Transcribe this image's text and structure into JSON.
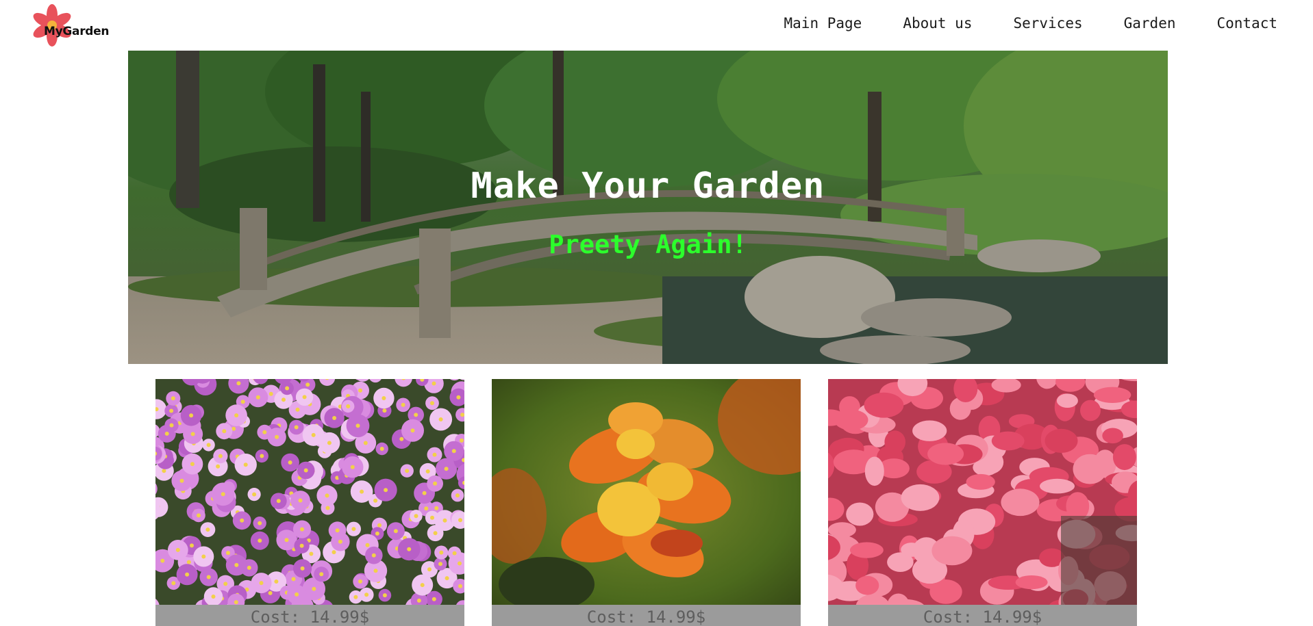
{
  "header": {
    "logo_text": "MyGarden",
    "nav": [
      {
        "label": "Main Page"
      },
      {
        "label": "About us"
      },
      {
        "label": "Services"
      },
      {
        "label": "Garden"
      },
      {
        "label": "Contact"
      }
    ]
  },
  "hero": {
    "title": "Make Your Garden",
    "subtitle": "Preety Again!"
  },
  "products": [
    {
      "image": "purple-aster-flowers",
      "cost": "Cost: 14.99$"
    },
    {
      "image": "orange-alstroemeria-flowers",
      "cost": "Cost: 14.99$"
    },
    {
      "image": "pink-azalea-flowers",
      "cost": "Cost: 14.99$"
    }
  ],
  "colors": {
    "subtitle": "#2cff2c",
    "cost_bar": "#9b9b9b",
    "logo_flower": "#e8525b"
  }
}
